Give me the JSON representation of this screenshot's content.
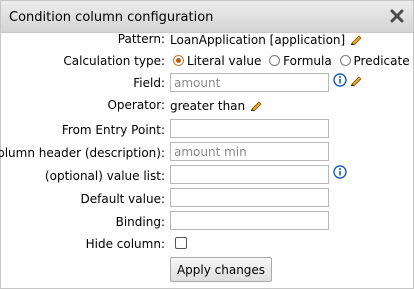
{
  "dialog": {
    "title": "Condition column configuration",
    "close_icon": "close-x-icon"
  },
  "pattern": {
    "label": "Pattern:",
    "value": "LoanApplication [application]"
  },
  "calc_type": {
    "label": "Calculation type:",
    "options": [
      {
        "label": "Literal value",
        "selected": true
      },
      {
        "label": "Formula",
        "selected": false
      },
      {
        "label": "Predicate",
        "selected": false
      }
    ]
  },
  "field": {
    "label": "Field:",
    "value": "amount"
  },
  "operator": {
    "label": "Operator:",
    "value": "greater than"
  },
  "from_entry_point": {
    "label": "From Entry Point:",
    "value": ""
  },
  "column_header": {
    "label": "Column header (description):",
    "value": "amount min"
  },
  "value_list": {
    "label": "(optional) value list:",
    "value": ""
  },
  "default_value": {
    "label": "Default value:",
    "value": ""
  },
  "binding": {
    "label": "Binding:",
    "value": ""
  },
  "hide_column": {
    "label": "Hide column:",
    "checked": false
  },
  "apply_button": {
    "label": "Apply changes"
  },
  "colors": {
    "info_icon": "#1a5fb4",
    "pencil_icon": "#e0a020",
    "radio_selected": "#b85f17"
  }
}
